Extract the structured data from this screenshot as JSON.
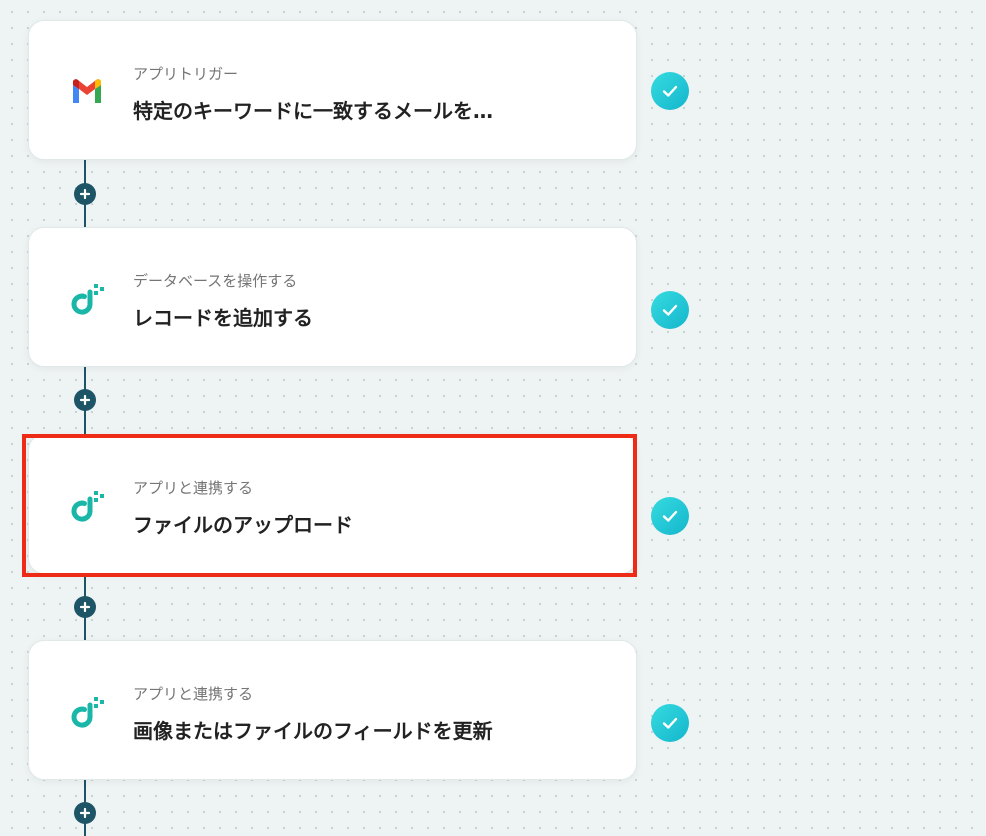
{
  "steps": [
    {
      "app": "gmail",
      "icon": "gmail-icon",
      "category": "アプリトリガー",
      "title": "特定のキーワードに一致するメールを…",
      "status": "completed"
    },
    {
      "app": "database",
      "icon": "yoom-database-icon",
      "category": "データベースを操作する",
      "title": "レコードを追加する",
      "status": "completed"
    },
    {
      "app": "database",
      "icon": "yoom-database-icon",
      "category": "アプリと連携する",
      "title": "ファイルのアップロード",
      "status": "completed",
      "highlighted": true
    },
    {
      "app": "database",
      "icon": "yoom-database-icon",
      "category": "アプリと連携する",
      "title": "画像またはファイルのフィールドを更新",
      "status": "completed"
    }
  ],
  "colors": {
    "connector": "#1d5566",
    "check": "#1fc4d4",
    "highlight": "#ee2b16",
    "brand_teal": "#1ab7a8"
  }
}
